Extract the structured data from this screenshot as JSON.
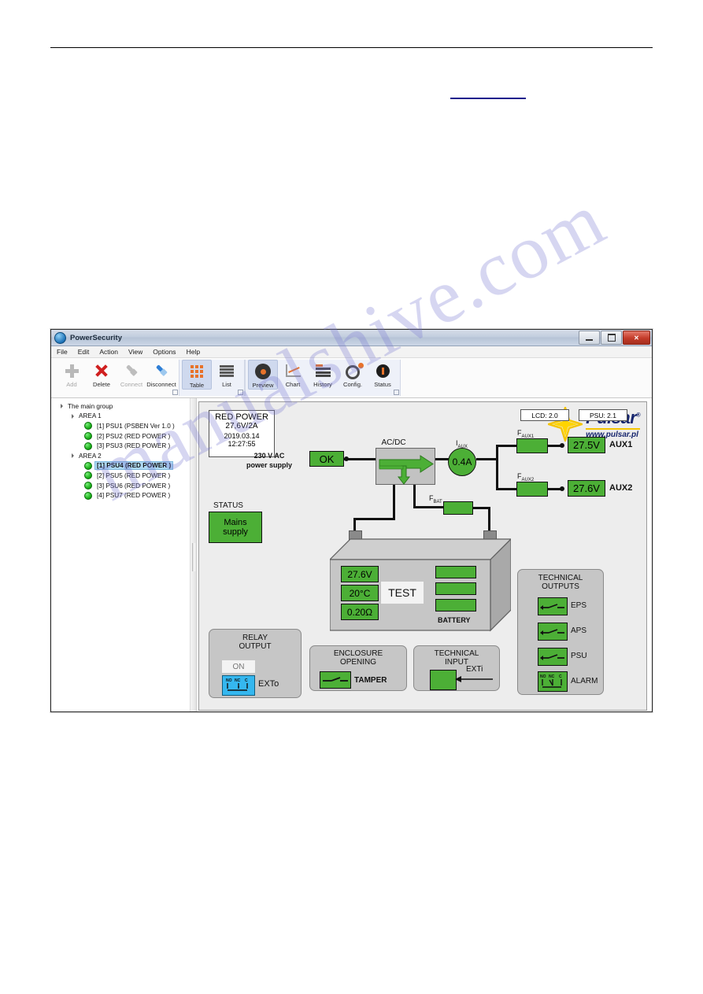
{
  "window": {
    "title": "PowerSecurity",
    "buttons": {
      "minimize": "minimize-icon",
      "maximize": "maximize-icon",
      "close": "✕"
    }
  },
  "menu": {
    "items": [
      "File",
      "Edit",
      "Action",
      "View",
      "Options",
      "Help"
    ]
  },
  "toolbar": {
    "groups": [
      {
        "name": "edit",
        "items": [
          {
            "label": "Add",
            "icon": "plus-icon",
            "state": "disabled"
          },
          {
            "label": "Delete",
            "icon": "x-mark-icon",
            "state": "enabled"
          },
          {
            "label": "Connect",
            "icon": "plug-icon",
            "state": "disabled"
          },
          {
            "label": "Disconnect",
            "icon": "plug-blue-icon",
            "state": "enabled"
          }
        ]
      },
      {
        "name": "view",
        "items": [
          {
            "label": "Table",
            "icon": "grid-icon",
            "state": "selected"
          },
          {
            "label": "List",
            "icon": "list-icon",
            "state": "enabled"
          }
        ]
      },
      {
        "name": "tools",
        "items": [
          {
            "label": "Preview",
            "icon": "eye-icon",
            "state": "selected"
          },
          {
            "label": "Chart",
            "icon": "chart-icon",
            "state": "enabled"
          },
          {
            "label": "History",
            "icon": "history-icon",
            "state": "enabled"
          },
          {
            "label": "Config.",
            "icon": "gear-icon",
            "state": "enabled"
          },
          {
            "label": "Status",
            "icon": "status-icon",
            "state": "enabled"
          }
        ]
      }
    ]
  },
  "tree": {
    "nodes": [
      {
        "level": 0,
        "label": "The main group",
        "type": "group",
        "selected": false
      },
      {
        "level": 1,
        "label": "AREA 1",
        "type": "group",
        "selected": false
      },
      {
        "level": 2,
        "label": "[1] PSU1 (PSBEN Ver 1.0 )",
        "type": "device",
        "selected": false
      },
      {
        "level": 2,
        "label": "[2] PSU2 (RED POWER )",
        "type": "device",
        "selected": false
      },
      {
        "level": 2,
        "label": "[3] PSU3 (RED POWER )",
        "type": "device",
        "selected": false
      },
      {
        "level": 1,
        "label": "AREA 2",
        "type": "group",
        "selected": false
      },
      {
        "level": 2,
        "label": "[1] PSU4 (RED POWER )",
        "type": "device",
        "selected": true
      },
      {
        "level": 2,
        "label": "[2] PSU5 (RED POWER )",
        "type": "device",
        "selected": false
      },
      {
        "level": 2,
        "label": "[3] PSU6 (RED POWER )",
        "type": "device",
        "selected": false
      },
      {
        "level": 2,
        "label": "[4] PSU7 (RED POWER )",
        "type": "device",
        "selected": false
      }
    ]
  },
  "diagram": {
    "info": {
      "model": "RED POWER",
      "rating": "27,6V/2A",
      "date": "2019.03.14",
      "time": "12:27:55"
    },
    "versions": {
      "lcd": "LCD: 2.0",
      "psu": "PSU: 2.1"
    },
    "mains": {
      "label_line1": "230 V AC",
      "label_line2": "power supply",
      "value": "OK"
    },
    "acdc": {
      "label": "AC/DC"
    },
    "current": {
      "label": "I",
      "sub": "AUX",
      "value": "0.4A"
    },
    "fuses": {
      "aux1": {
        "label": "F",
        "sub": "AUX1"
      },
      "aux2": {
        "label": "F",
        "sub": "AUX2"
      },
      "bat": {
        "label": "F",
        "sub": "BAT"
      }
    },
    "outputs": [
      {
        "voltage": "27.5V",
        "name": "AUX1"
      },
      {
        "voltage": "27.6V",
        "name": "AUX2"
      }
    ],
    "status": {
      "title": "STATUS",
      "line1": "Mains",
      "line2": "supply"
    },
    "battery": {
      "caption": "BATTERY",
      "voltage": "27.6V",
      "temperature": "20°C",
      "resistance": "0.20Ω",
      "test_button": "TEST",
      "bars": 3
    },
    "relay_output": {
      "title_line1": "RELAY",
      "title_line2": "OUTPUT",
      "state": "ON",
      "terminal": "EXTo",
      "contacts": [
        "NO",
        "NC",
        "C"
      ]
    },
    "enclosure": {
      "title_line1": "ENCLOSURE",
      "title_line2": "OPENING",
      "label": "TAMPER"
    },
    "technical_input": {
      "title_line1": "TECHNICAL",
      "title_line2": "INPUT",
      "label": "EXTi"
    },
    "technical_outputs": {
      "title_line1": "TECHNICAL",
      "title_line2": "OUTPUTS",
      "items": [
        {
          "label": "EPS",
          "icon": "switch-icon"
        },
        {
          "label": "APS",
          "icon": "switch-icon"
        },
        {
          "label": "PSU",
          "icon": "switch-icon"
        },
        {
          "label": "ALARM",
          "icon": "relay-contacts-icon"
        }
      ],
      "alarm_contacts": [
        "NO",
        "NC",
        "C"
      ]
    },
    "logo": {
      "brand": "Pulsar",
      "registered": "®",
      "url": "www.pulsar.pl"
    }
  },
  "watermark": {
    "text": "manualshive.com"
  },
  "colors": {
    "green": "#4caf36",
    "brand_navy": "#16256e",
    "brand_yellow": "#f5c400",
    "accent_orange": "#e8722a",
    "selection_blue": "#aed9f4"
  }
}
